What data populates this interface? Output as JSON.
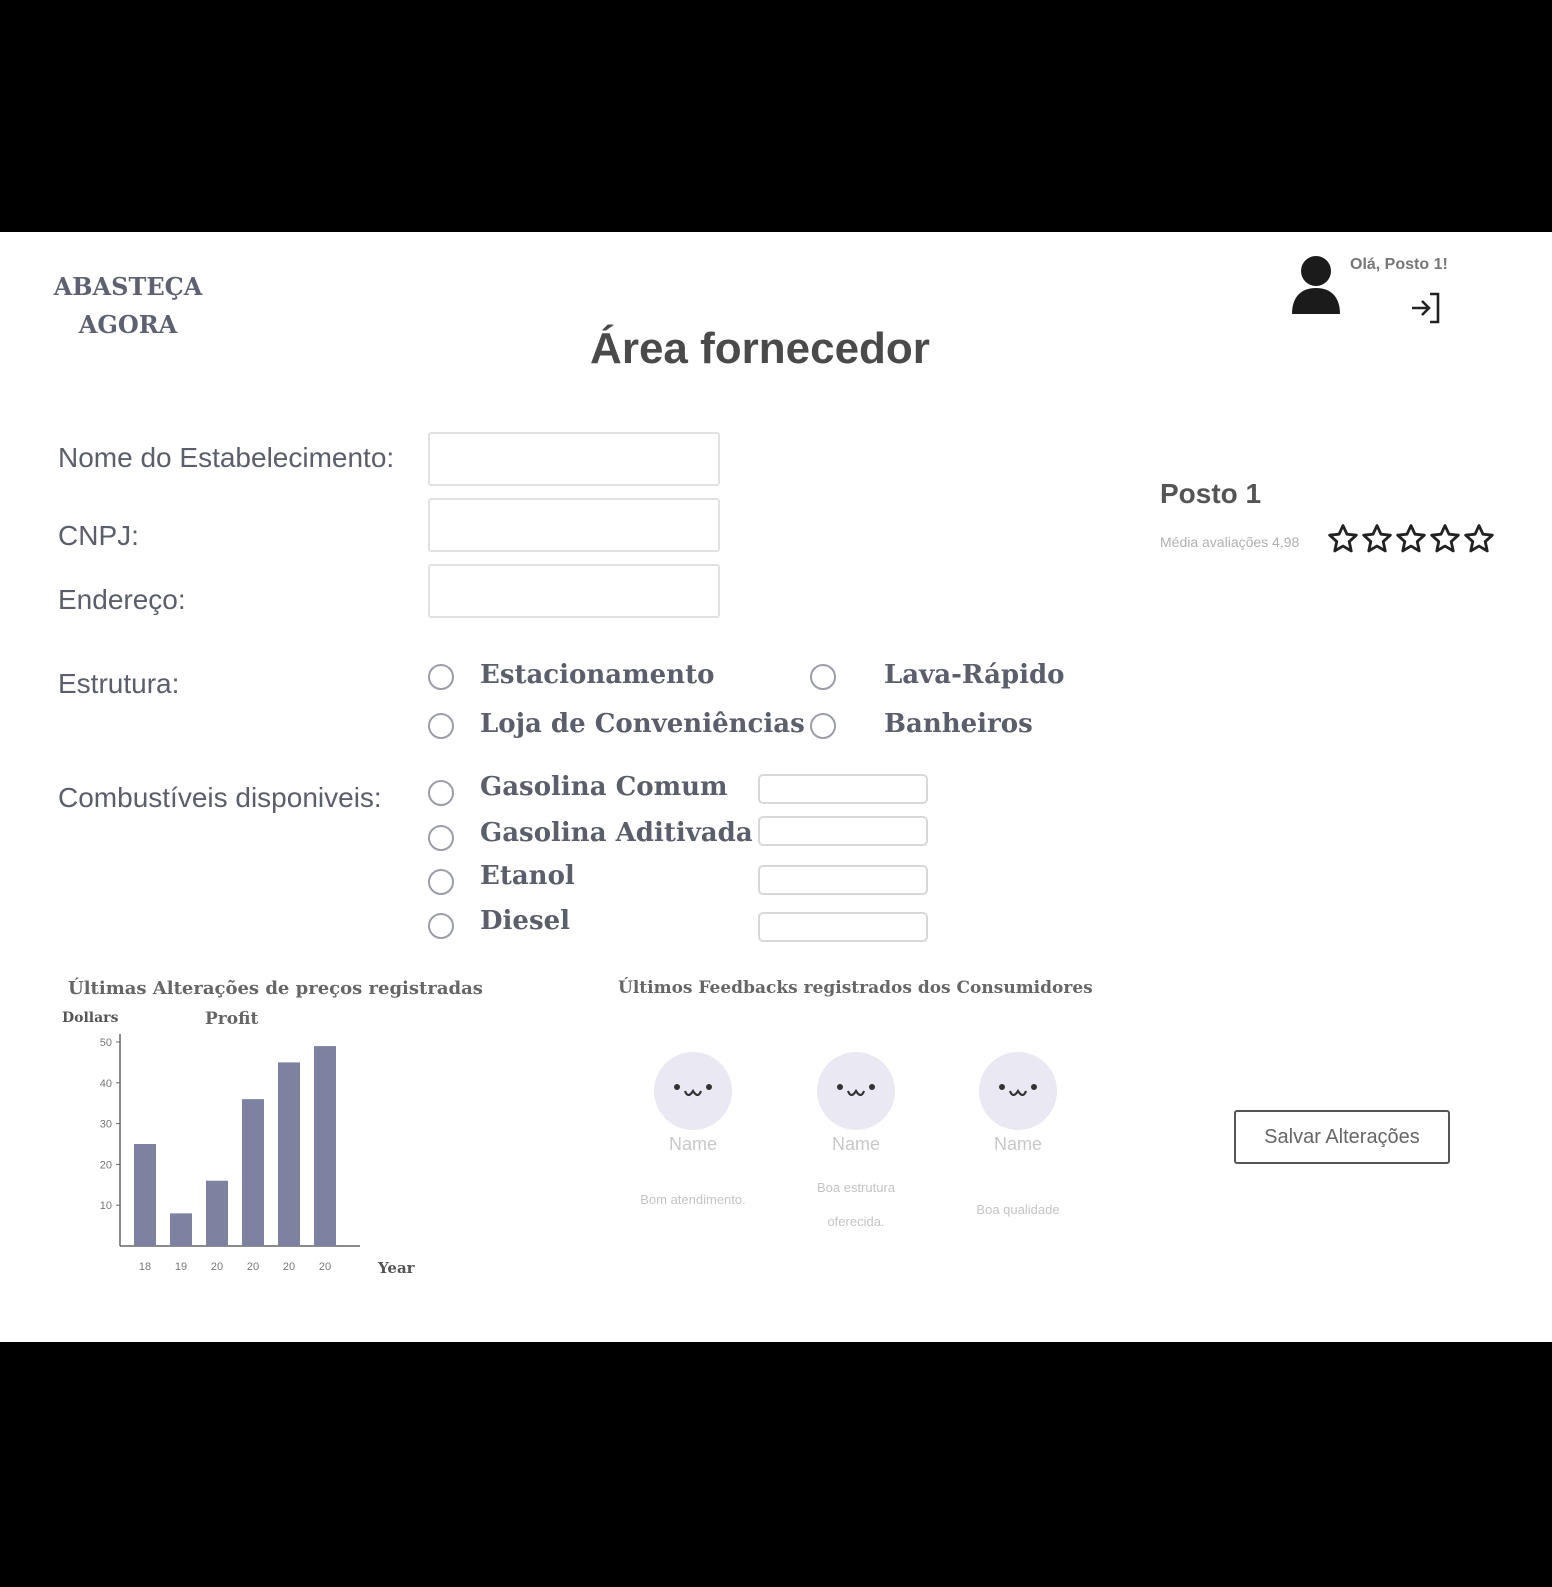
{
  "header": {
    "logo_line1": "ABASTEÇA",
    "logo_line2": "AGORA",
    "page_title": "Área fornecedor",
    "greeting": "Olá, Posto 1!",
    "avatar_icon": "user-icon",
    "logout_icon": "logout-icon"
  },
  "form": {
    "name_label": "Nome do Estabelecimento:",
    "cnpj_label": "CNPJ:",
    "address_label": "Endereço:",
    "name_value": "",
    "cnpj_value": "",
    "address_value": "",
    "structure_label": "Estrutura:",
    "structure_options": [
      "Estacionamento",
      "Lava-Rápido",
      "Loja de Conveniências",
      "Banheiros"
    ],
    "fuels_label": "Combustíveis disponiveis:",
    "fuel_options": [
      "Gasolina Comum",
      "Gasolina Aditivada",
      "Etanol",
      "Diesel"
    ],
    "fuel_prices": [
      "",
      "",
      "",
      ""
    ]
  },
  "profile": {
    "name": "Posto 1",
    "rating_label": "Média avaliações 4,98",
    "stars_total": 5,
    "star_icon": "star-outline-icon"
  },
  "price_history": {
    "section_title": "Últimas Alterações de preços registradas"
  },
  "chart_data": {
    "type": "bar",
    "title": "Profit",
    "ylabel": "Dollars",
    "xlabel": "Year",
    "categories": [
      "18",
      "19",
      "20",
      "20",
      "20",
      "20"
    ],
    "values": [
      25,
      8,
      16,
      36,
      45,
      49
    ],
    "ylim": [
      0,
      50
    ],
    "yticks": [
      10,
      20,
      30,
      40,
      50
    ],
    "bar_color": "#7c82a0",
    "grid": false
  },
  "feedback": {
    "section_title": "Últimos Feedbacks registrados dos Consumidores",
    "items": [
      {
        "name": "Name",
        "comment_lines": [
          "Bom atendimento."
        ]
      },
      {
        "name": "Name",
        "comment_lines": [
          "Boa estrutura",
          "oferecida."
        ]
      },
      {
        "name": "Name",
        "comment_lines": [
          "Boa qualidade"
        ]
      }
    ],
    "face_icon": "smiley-face-icon"
  },
  "actions": {
    "save_label": "Salvar Alterações"
  }
}
